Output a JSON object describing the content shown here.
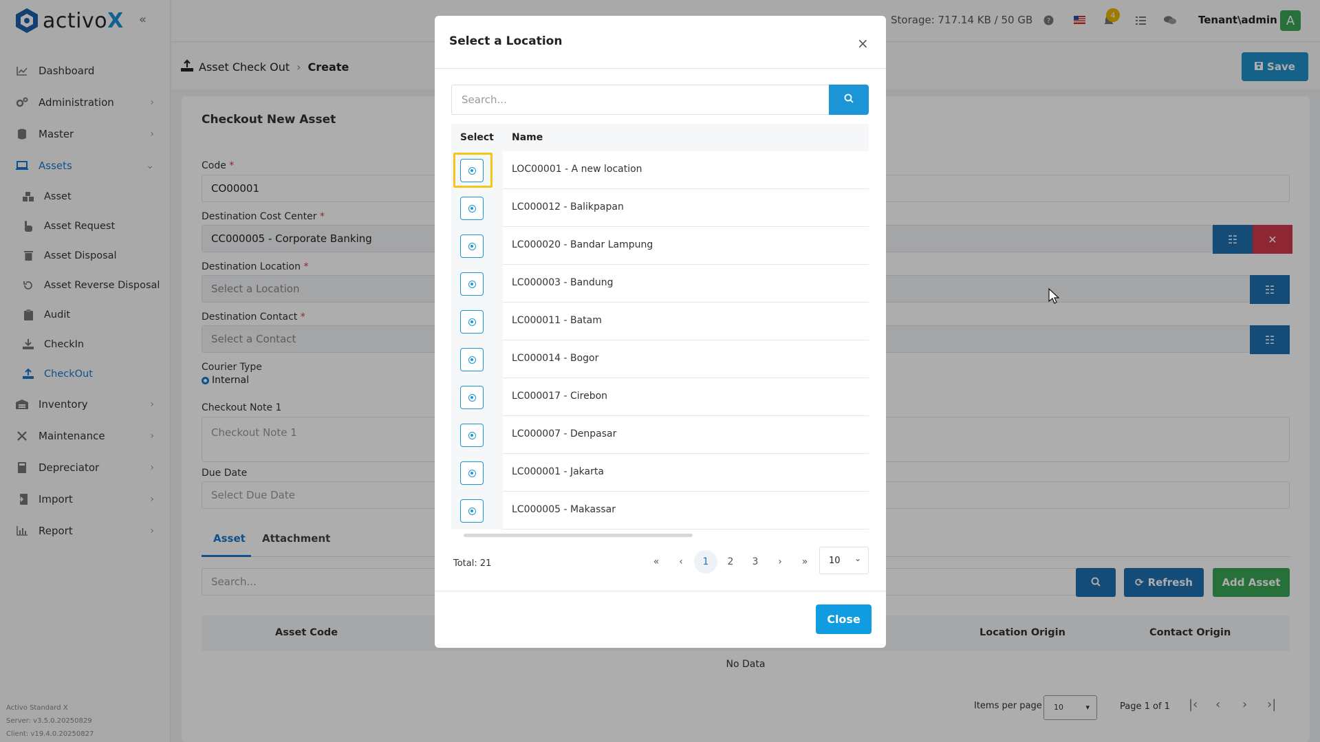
{
  "brand": {
    "name_prefix": "activo",
    "name_suffix": "X"
  },
  "sidebar": {
    "items": [
      {
        "label": "Dashboard",
        "icon": "chart-line-icon",
        "has_chevron": false
      },
      {
        "label": "Administration",
        "icon": "cogs-icon",
        "has_chevron": true
      },
      {
        "label": "Master",
        "icon": "database-icon",
        "has_chevron": true
      },
      {
        "label": "Assets",
        "icon": "laptop-icon",
        "has_chevron": true,
        "expanded": true
      },
      {
        "label": "Inventory",
        "icon": "warehouse-icon",
        "has_chevron": true
      },
      {
        "label": "Maintenance",
        "icon": "tools-icon",
        "has_chevron": true
      },
      {
        "label": "Depreciator",
        "icon": "calculator-icon",
        "has_chevron": true
      },
      {
        "label": "Import",
        "icon": "file-import-icon",
        "has_chevron": true
      },
      {
        "label": "Report",
        "icon": "chart-bar-icon",
        "has_chevron": true
      }
    ],
    "asset_subitems": [
      {
        "label": "Asset",
        "icon": "boxes-icon"
      },
      {
        "label": "Asset Request",
        "icon": "hand-icon"
      },
      {
        "label": "Asset Disposal",
        "icon": "trash-icon"
      },
      {
        "label": "Asset Reverse Disposal",
        "icon": "undo-icon"
      },
      {
        "label": "Audit",
        "icon": "clipboard-icon"
      },
      {
        "label": "CheckIn",
        "icon": "download-icon"
      },
      {
        "label": "CheckOut",
        "icon": "upload-icon",
        "active": true
      }
    ],
    "footer": {
      "product": "Activo Standard X",
      "server": "Server: v3.5.0.20250829",
      "client": "Client: v19.4.0.20250827"
    }
  },
  "topbar": {
    "storage": "Storage: 717.14 KB / 50 GB",
    "notification_count": "4",
    "tenant": "Tenant\\admin",
    "avatar_letter": "A"
  },
  "header": {
    "breadcrumb_parent": "Asset Check Out",
    "breadcrumb_current": "Create",
    "save_label": "Save"
  },
  "form": {
    "title": "Checkout New Asset",
    "code_label": "Code",
    "code_value": "CO00001",
    "cost_center_label": "Destination Cost Center",
    "cost_center_value": "CC000005 - Corporate Banking",
    "location_label": "Destination Location",
    "location_placeholder": "Select a Location",
    "contact_label": "Destination Contact",
    "contact_placeholder": "Select a Contact",
    "courier_label": "Courier Type",
    "courier_value": "Internal",
    "note_label": "Checkout Note 1",
    "note_placeholder": "Checkout Note 1",
    "due_label": "Due Date",
    "due_placeholder": "Select Due Date"
  },
  "tabs": {
    "asset": "Asset",
    "attachment": "Attachment"
  },
  "asset_table": {
    "search_placeholder": "Search...",
    "refresh_label": "Refresh",
    "add_label": "Add Asset",
    "columns": [
      "Asset Code",
      "Location Origin",
      "Contact Origin"
    ],
    "empty": "No Data",
    "items_per_page_label": "Items per page",
    "items_per_page_value": "10",
    "page_info": "Page 1 of 1"
  },
  "modal": {
    "title": "Select a Location",
    "search_placeholder": "Search...",
    "col_select": "Select",
    "col_name": "Name",
    "rows": [
      "LOC00001 - A new location",
      "LC000012 - Balikpapan",
      "LC000020 - Bandar Lampung",
      "LC000003 - Bandung",
      "LC000011 - Batam",
      "LC000014 - Bogor",
      "LC000017 - Cirebon",
      "LC000007 - Denpasar",
      "LC000001 - Jakarta",
      "LC000005 - Makassar"
    ],
    "total": "Total: 21",
    "pages": [
      "1",
      "2",
      "3"
    ],
    "current_page": "1",
    "page_size": "10",
    "close_label": "Close"
  },
  "colors": {
    "primary": "#1b95d6",
    "dark_blue": "#1f6fb0",
    "danger": "#d33a4c",
    "success": "#3aa655",
    "highlight": "#f5c518"
  }
}
